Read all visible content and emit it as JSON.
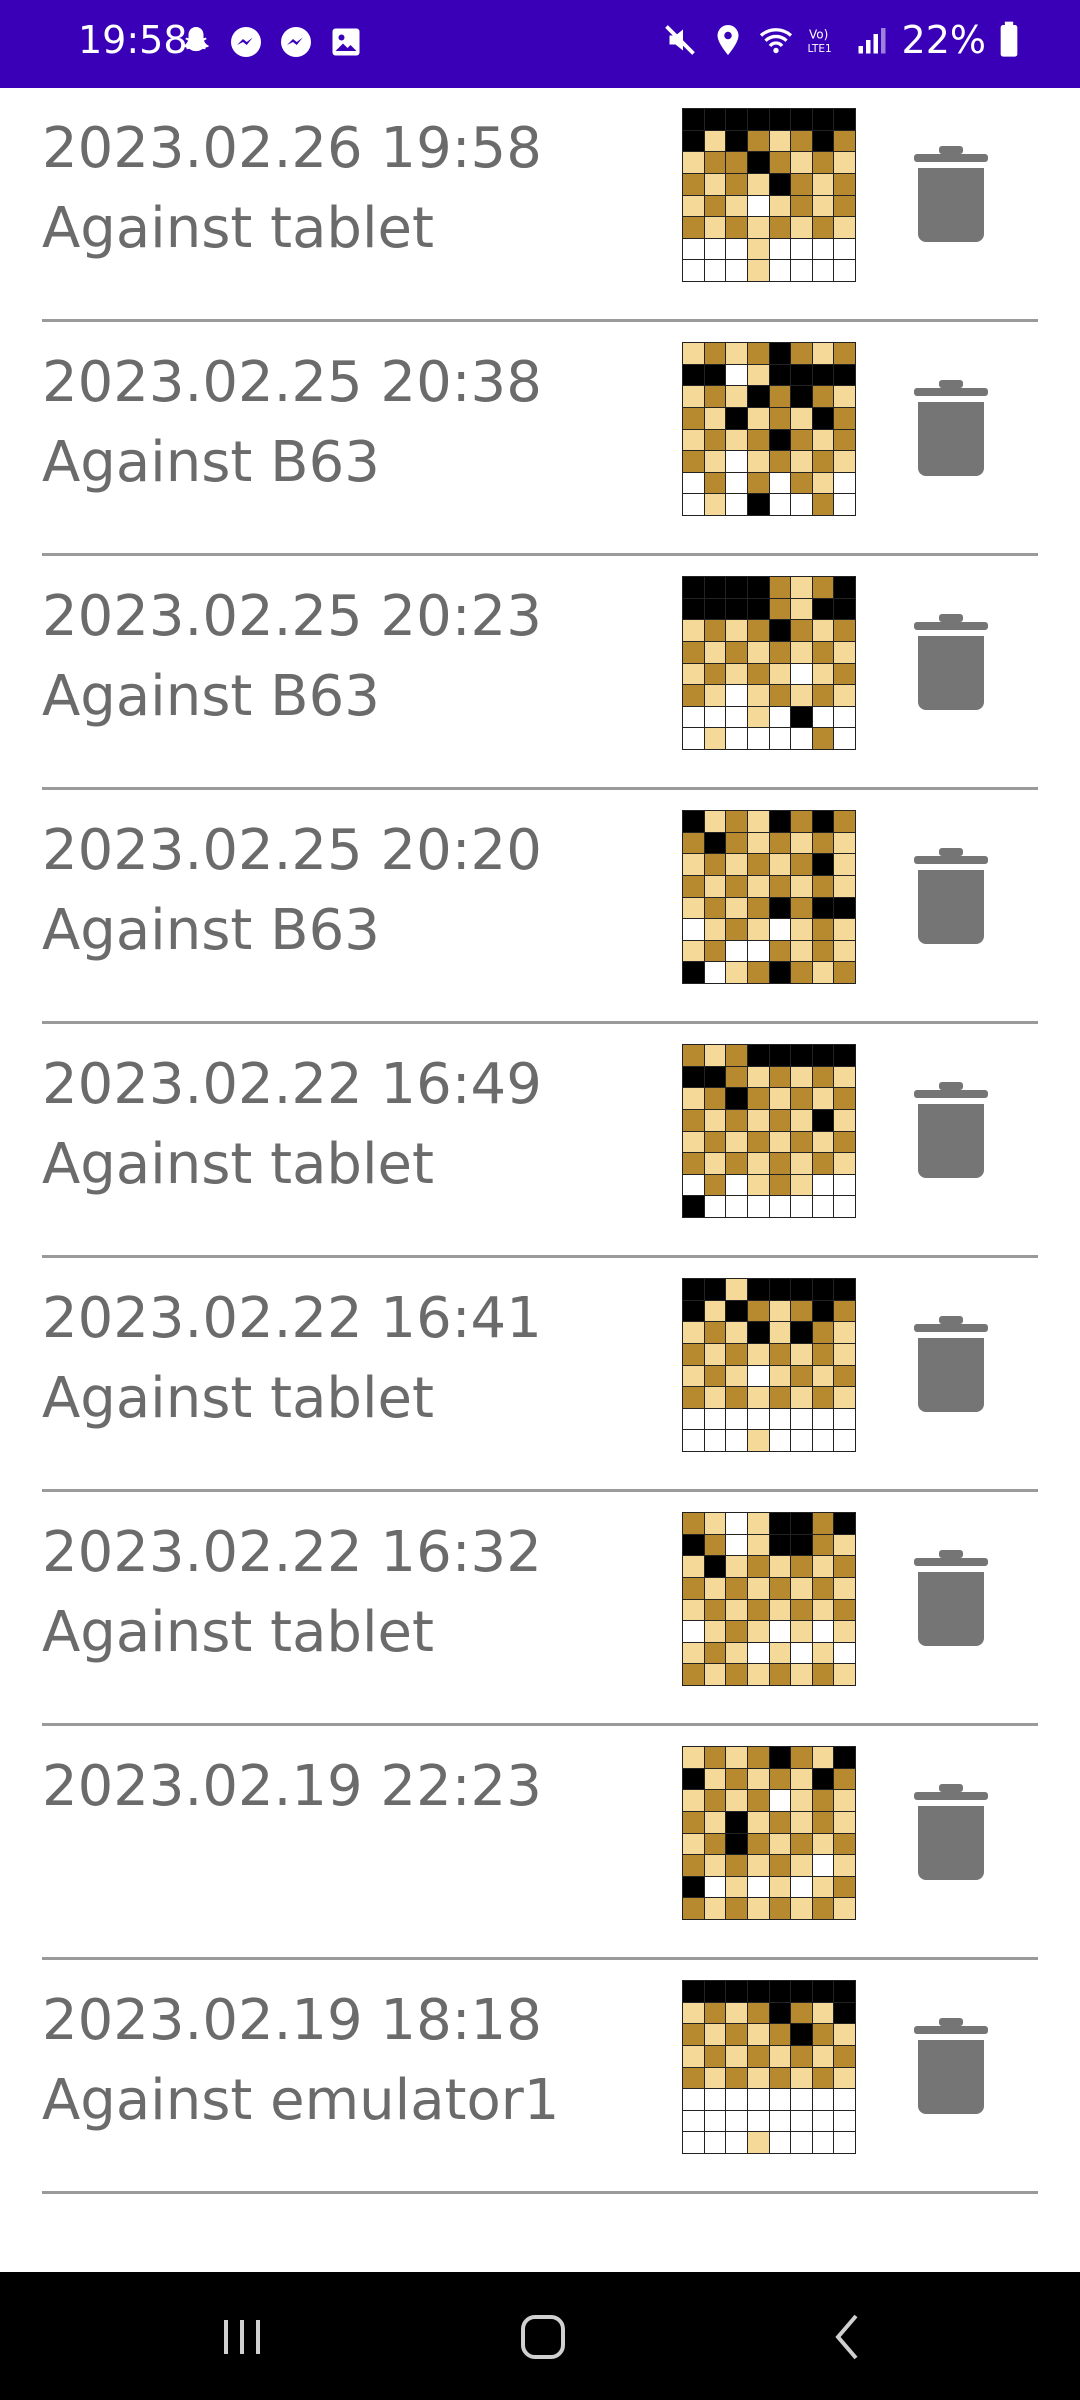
{
  "status_bar": {
    "time": "19:58",
    "battery": "22%",
    "left_icons": [
      "snapchat-icon",
      "messenger-icon",
      "messenger-icon",
      "gallery-icon"
    ],
    "right_icons": [
      "mute-icon",
      "location-icon",
      "wifi-icon",
      "volte-icon",
      "signal-icon",
      "battery-icon"
    ]
  },
  "colors": {
    "status_bar": "#3a00b8",
    "light_square": "#f5d998",
    "dark_square": "#b88a30",
    "black_piece": "#000000",
    "white_piece": "#ffffff",
    "text": "#6b6b6b",
    "trash": "#757575"
  },
  "games": [
    {
      "date": "2023.02.26 19:58",
      "opponent": "Against tablet",
      "board": [
        "KKKKKKKK",
        "KLKDLDKD",
        "LDDKDLDL",
        "DLDLKDLD",
        "LDLWLDLD",
        "DLDLDLDL",
        "WWWLWWWW",
        "WWWLWWWW"
      ]
    },
    {
      "date": "2023.02.25 20:38",
      "opponent": "Against B63",
      "board": [
        "LDLDKDLD",
        "KKWLKKKK",
        "LDLKDKDL",
        "DLKLDLKD",
        "LDLDKDLD",
        "DLWLDLDL",
        "WDWDWDLW",
        "WLWKWWDW"
      ]
    },
    {
      "date": "2023.02.25 20:23",
      "opponent": "Against B63",
      "board": [
        "KKKKDLDK",
        "KKKKDLKK",
        "LDLDKDLD",
        "DLDLDLDL",
        "LDLDLWLD",
        "DLWLDLDL",
        "WWWLWKWW",
        "WLWWWWDW"
      ]
    },
    {
      "date": "2023.02.25 20:20",
      "opponent": "Against B63",
      "board": [
        "KLDLKDKD",
        "DKDLDLDL",
        "LDLDLDKL",
        "DLDLDLDL",
        "LDLDKDKK",
        "WLDLWLDL",
        "LDWWDLDL",
        "KWLDKDLD"
      ]
    },
    {
      "date": "2023.02.22 16:49",
      "opponent": "Against tablet",
      "board": [
        "DLDKKKKK",
        "KKDLDLDL",
        "LDKDLDLD",
        "DLDLDLKL",
        "LDLDLDLD",
        "DLDLDLDL",
        "WDWLDLWW",
        "KWWWWWWW"
      ]
    },
    {
      "date": "2023.02.22 16:41",
      "opponent": "Against tablet",
      "board": [
        "KKLKKKKK",
        "KLKDLDKD",
        "LDLKLKDL",
        "DLDLDLDL",
        "LDLWLDLD",
        "DLDLDLDL",
        "WWWWWWWW",
        "WWWLWWWW"
      ]
    },
    {
      "date": "2023.02.22 16:32",
      "opponent": "Against tablet",
      "board": [
        "DLWLKKDK",
        "KDWLKKDL",
        "LKLDLDLD",
        "DLDLDLDL",
        "LDLDLDLD",
        "WLDLWLWL",
        "LDLWLWLW",
        "DLDLDLDL"
      ]
    },
    {
      "date": "2023.02.19 22:23",
      "opponent": "",
      "board": [
        "LDLDKDLK",
        "KLDLDLKD",
        "LDLDWLDL",
        "DLKLDLDL",
        "LDKDLDLD",
        "DLDLDLWL",
        "KWLWLWLD",
        "DLDLDLDL"
      ]
    },
    {
      "date": "2023.02.19 18:18",
      "opponent": "Against emulator1",
      "board": [
        "KKKKKKKK",
        "LDLDKDLK",
        "DLDLDKDL",
        "LDLDLDLD",
        "DLDLDLDL",
        "WWWWWWWW",
        "WWWWWWWW",
        "WWWLWWWW"
      ]
    }
  ],
  "nav_bar": {
    "buttons": [
      "recents-icon",
      "home-icon",
      "back-icon"
    ]
  }
}
